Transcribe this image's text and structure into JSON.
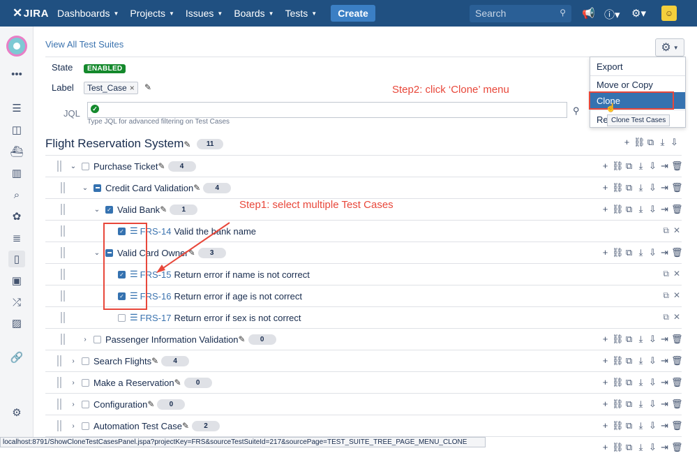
{
  "topbar": {
    "logo": "JIRA",
    "nav": [
      {
        "label": "Dashboards"
      },
      {
        "label": "Projects"
      },
      {
        "label": "Issues"
      },
      {
        "label": "Boards"
      },
      {
        "label": "Tests"
      }
    ],
    "create_label": "Create",
    "search_placeholder": "Search"
  },
  "page": {
    "view_all_link": "View All Test Suites",
    "state_label": "State",
    "state_value": "ENABLED",
    "label_label": "Label",
    "label_value": "Test_Case",
    "jql_label": "JQL",
    "jql_help": "Type JQL for advanced filtering on Test Cases"
  },
  "menu": {
    "items": [
      "Export",
      "Move or Copy",
      "Clone",
      "Re"
    ],
    "tooltip": "Clone Test Cases"
  },
  "annotations": {
    "step1": "Step1: select multiple Test Cases",
    "step2": "Step2: click ‘Clone’ menu"
  },
  "tree": {
    "title": "Flight Reservation System",
    "count": "11",
    "rows": [
      {
        "name": "Purchase Ticket",
        "count": "4"
      },
      {
        "name": "Credit Card Validation",
        "count": "4"
      },
      {
        "name": "Valid Bank",
        "count": "1"
      },
      {
        "key": "FRS-14",
        "summary": "Valid the bank name"
      },
      {
        "name": "Valid Card Owner",
        "count": "3"
      },
      {
        "key": "FRS-15",
        "summary": "Return error if name is not correct"
      },
      {
        "key": "FRS-16",
        "summary": "Return error if age is not correct"
      },
      {
        "key": "FRS-17",
        "summary": "Return error if sex is not correct"
      },
      {
        "name": "Passenger Information Validation",
        "count": "0"
      },
      {
        "name": "Search Flights",
        "count": "4"
      },
      {
        "name": "Make a Reservation",
        "count": "0"
      },
      {
        "name": "Configuration",
        "count": "0"
      },
      {
        "name": "Automation Test Case",
        "count": "2"
      }
    ]
  },
  "statusbar": "localhost:8791/ShowCloneTestCasesPanel.jspa?projectKey=FRS&sourceTestSuiteId=217&sourcePage=TEST_SUITE_TREE_PAGE_MENU_CLONE"
}
